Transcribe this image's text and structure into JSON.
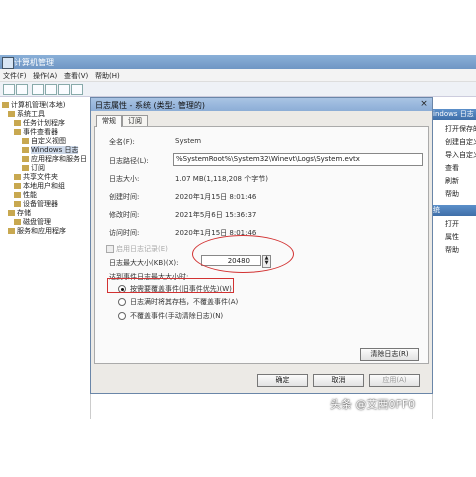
{
  "window": {
    "title": "计算机管理"
  },
  "menu": [
    "文件(F)",
    "操作(A)",
    "查看(V)",
    "帮助(H)"
  ],
  "tree": [
    "计算机管理(本地)",
    "系统工具",
    "任务计划程序",
    "事件查看器",
    "自定义视图",
    "Windows 日志",
    "应用程序和服务日",
    "订阅",
    "共享文件夹",
    "本地用户和组",
    "性能",
    "设备管理器",
    "存储",
    "磁盘管理",
    "服务和应用程序"
  ],
  "actions": {
    "header1": "indows 日志",
    "items1": [
      "打开保存的",
      "创建自定义",
      "导入自定义",
      "查看",
      "刷新",
      "帮助"
    ],
    "header2": "统",
    "items2": [
      "打开",
      "属性",
      "帮助"
    ]
  },
  "dialog": {
    "title": "日志属性 - 系统 (类型: 管理的)",
    "close": "×",
    "tabs": [
      "常规",
      "订阅"
    ],
    "fields": {
      "full_name_label": "全名(F):",
      "full_name": "System",
      "path_label": "日志路径(L):",
      "path": "%SystemRoot%\\System32\\Winevt\\Logs\\System.evtx",
      "size_label": "日志大小:",
      "size": "1.07 MB(1,118,208 个字节)",
      "created_label": "创建时间:",
      "created": "2020年1月15日 8:01:46",
      "modified_label": "修改时间:",
      "modified": "2021年5月6日 15:36:37",
      "accessed_label": "访问时间:",
      "accessed": "2020年1月15日 8:01:46"
    },
    "enable_logging": "启用日志记录(E)",
    "max_size_label": "日志最大大小(KB)(X):",
    "max_size": "20480",
    "when_full_label": "达到事件日志最大大小时:",
    "options": [
      "按需要覆盖事件(旧事件优先)(W)",
      "日志满时将其存档，不覆盖事件(A)",
      "不覆盖事件(手动清除日志)(N)"
    ],
    "clear_log": "清除日志(R)",
    "ok": "确定",
    "cancel": "取消",
    "apply": "应用(A)"
  },
  "watermark": "头条 @艾西0FF0",
  "colors": {
    "highlight": "#d23232",
    "title": "#8cadd6"
  }
}
